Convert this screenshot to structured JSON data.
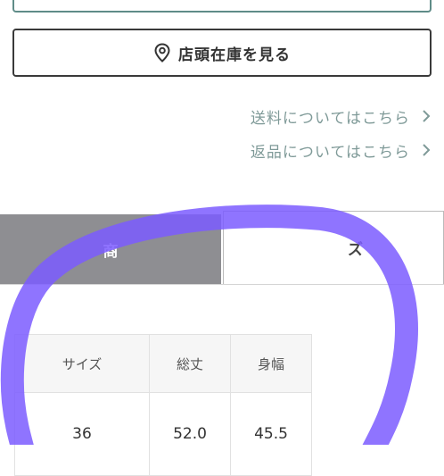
{
  "store_button": {
    "label": "店頭在庫を見る",
    "icon": "map-pin-icon"
  },
  "links": [
    {
      "label": "送料についてはこちら",
      "icon": "chevron-right-icon"
    },
    {
      "label": "返品についてはこちら",
      "icon": "chevron-right-icon"
    }
  ],
  "tabs": [
    {
      "label": "商",
      "active": false
    },
    {
      "label": "ズ",
      "active": true
    }
  ],
  "size_table": {
    "headers": [
      "サイズ",
      "総丈",
      "身幅"
    ],
    "rows": [
      [
        "36",
        "52.0",
        "45.5"
      ]
    ]
  },
  "colors": {
    "accent": "#5f8c88",
    "link": "#7f9a98",
    "tab_inactive": "#8e8e92",
    "scribble": "#7b5cff"
  }
}
